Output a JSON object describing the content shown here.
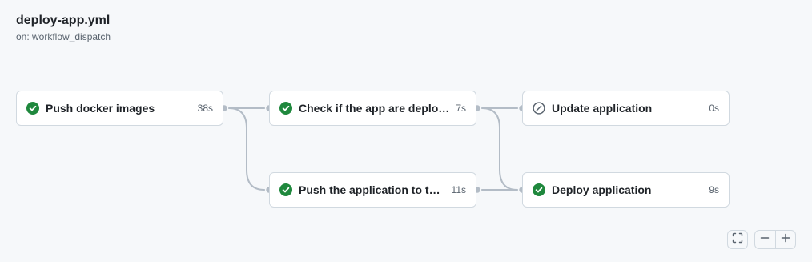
{
  "workflow": {
    "title": "deploy-app.yml",
    "trigger": "on: workflow_dispatch"
  },
  "jobs": [
    {
      "name": "Push docker images",
      "duration": "38s",
      "status": "success"
    },
    {
      "name": "Check if the app are deploy...",
      "duration": "7s",
      "status": "success"
    },
    {
      "name": "Push the application to th...",
      "duration": "11s",
      "status": "success"
    },
    {
      "name": "Update application",
      "duration": "0s",
      "status": "skipped"
    },
    {
      "name": "Deploy application",
      "duration": "9s",
      "status": "success"
    }
  ],
  "controls": {
    "fit_icon": "fullscreen-icon",
    "zoom_out_icon": "minus-icon",
    "zoom_in_icon": "plus-icon"
  },
  "colors": {
    "success": "#1f883d",
    "skipped": "#59636e",
    "connector": "#b3bcc6"
  }
}
